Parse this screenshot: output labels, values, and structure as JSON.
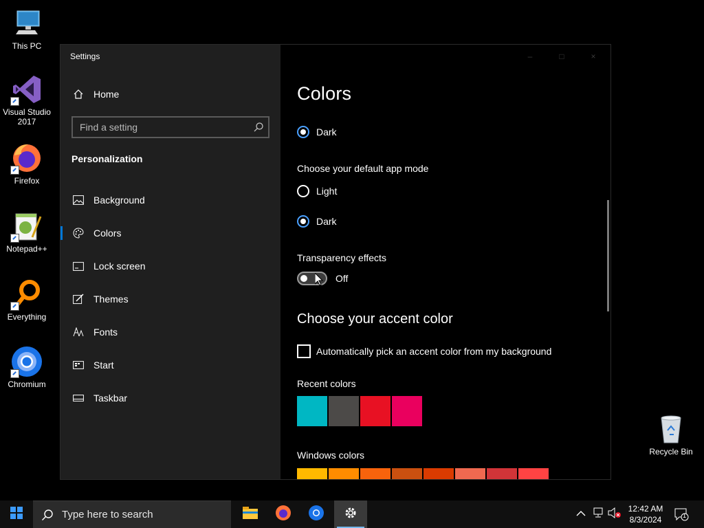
{
  "desktop": {
    "icons": [
      {
        "label": "This PC"
      },
      {
        "label": "Visual Studio 2017"
      },
      {
        "label": "Firefox"
      },
      {
        "label": "Notepad++"
      },
      {
        "label": "Everything"
      },
      {
        "label": "Chromium"
      }
    ],
    "recycle_bin": {
      "label": "Recycle Bin"
    }
  },
  "window": {
    "title": "Settings",
    "nav": {
      "home": "Home",
      "search_placeholder": "Find a setting",
      "section": "Personalization",
      "items": [
        {
          "label": "Background",
          "icon": "picture-icon"
        },
        {
          "label": "Colors",
          "icon": "palette-icon",
          "active": true
        },
        {
          "label": "Lock screen",
          "icon": "lock-screen-icon"
        },
        {
          "label": "Themes",
          "icon": "brush-icon"
        },
        {
          "label": "Fonts",
          "icon": "fonts-icon"
        },
        {
          "label": "Start",
          "icon": "start-icon"
        },
        {
          "label": "Taskbar",
          "icon": "taskbar-icon"
        }
      ]
    },
    "content": {
      "title": "Colors",
      "windows_mode_option": "Dark",
      "app_mode_heading": "Choose your default app mode",
      "app_mode_options": [
        {
          "label": "Light",
          "selected": false
        },
        {
          "label": "Dark",
          "selected": true
        }
      ],
      "transparency_heading": "Transparency effects",
      "transparency_state": "Off",
      "accent_heading": "Choose your accent color",
      "auto_accent_label": "Automatically pick an accent color from my background",
      "recent_colors_heading": "Recent colors",
      "recent_colors": [
        "#00b7c3",
        "#4c4a48",
        "#e81123",
        "#ea005e"
      ],
      "windows_colors_heading": "Windows colors",
      "windows_colors": [
        "#ffb900",
        "#ff8c00",
        "#f7630c",
        "#ca5010",
        "#da3b01",
        "#ef6950",
        "#d13438",
        "#ff4343"
      ]
    }
  },
  "taskbar": {
    "search_placeholder": "Type here to search",
    "apps": [
      "file-explorer",
      "firefox",
      "chromium",
      "settings"
    ],
    "clock_time": "12:42 AM",
    "clock_date": "8/3/2024",
    "notification_count": "1"
  },
  "colors": {
    "accent": "#0078d7",
    "nav_bg": "#1f1f1f",
    "taskbar_bg": "#101010"
  }
}
